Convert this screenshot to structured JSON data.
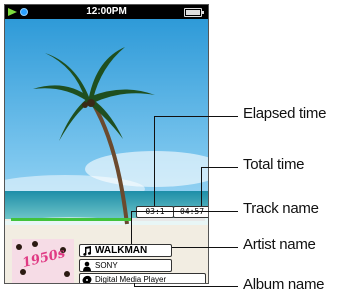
{
  "status_bar": {
    "clock": "12:00PM",
    "play_state": "playing",
    "battery_level": 1.0
  },
  "playback": {
    "elapsed_time": "03:1",
    "total_time": "04:57",
    "progress": 0.62
  },
  "track_info": {
    "track_name": "WALKMAN",
    "artist_name": "SONY",
    "album_name": "Digital Media Player"
  },
  "album_art": {
    "label": "1950s"
  },
  "callouts": {
    "elapsed_time": "Elapsed time",
    "total_time": "Total time",
    "track_name": "Track name",
    "artist_name": "Artist name",
    "album_name": "Album name"
  },
  "colors": {
    "progress": "#41c23c",
    "play_indicator": "#7ddc3e",
    "sky_top": "#2e9ad8",
    "sea": "#2fa8b0"
  },
  "icons": {
    "play_state": "play-icon",
    "mode": "shuffle-icon",
    "battery": "battery-icon",
    "track": "music-note-icon",
    "artist": "person-icon",
    "album": "disc-icon"
  }
}
